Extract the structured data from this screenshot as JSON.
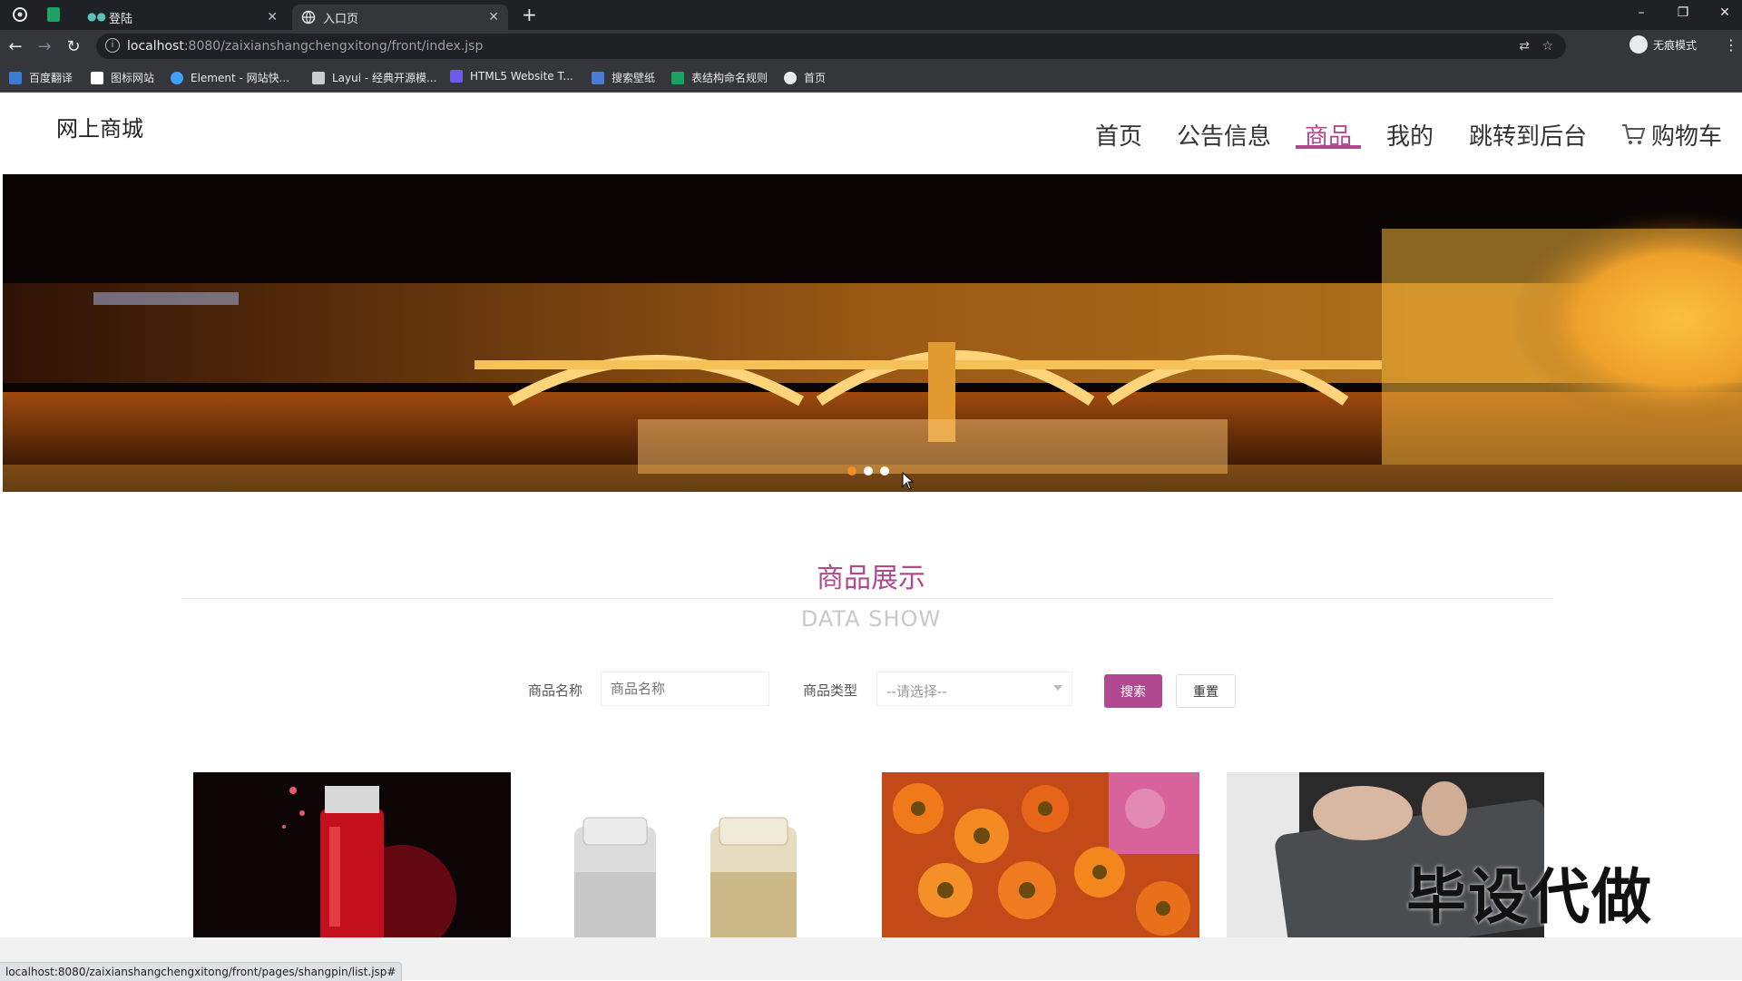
{
  "browser": {
    "tabs": [
      {
        "title": "登陆",
        "active": false
      },
      {
        "title": "入口页",
        "active": true
      }
    ],
    "new_tab": "+",
    "window_controls": {
      "minimize": "–",
      "maximize": "❐",
      "close": "✕"
    },
    "url_host": "localhost",
    "url_rest": ":8080/zaixianshangchengxitong/front/index.jsp",
    "profile_label": "无痕模式",
    "bookmarks": [
      {
        "label": "百度翻译",
        "color": "#3a7bd5"
      },
      {
        "label": "图标网站",
        "color": "#ffffff"
      },
      {
        "label": "Element - 网站快...",
        "color": "#409eff"
      },
      {
        "label": "Layui - 经典开源模...",
        "color": "#cccccc"
      },
      {
        "label": "HTML5 Website T...",
        "color": "#6c5ce7"
      },
      {
        "label": "搜索壁纸",
        "color": "#4a7bd5"
      },
      {
        "label": "表结构命名规则",
        "color": "#1aa260"
      },
      {
        "label": "首页",
        "color": "#e8eaed"
      }
    ],
    "status_url": "localhost:8080/zaixianshangchengxitong/front/pages/shangpin/list.jsp#"
  },
  "site": {
    "logo": "网上商城",
    "nav": [
      {
        "label": "首页",
        "active": false
      },
      {
        "label": "公告信息",
        "active": false
      },
      {
        "label": "商品",
        "active": true
      },
      {
        "label": "我的",
        "active": false
      },
      {
        "label": "跳转到后台",
        "active": false
      },
      {
        "label": "购物车",
        "active": false
      }
    ],
    "accent_color": "#b2488f"
  },
  "banner": {
    "slides": 3,
    "active_slide": 1
  },
  "section": {
    "title_cn": "商品展示",
    "title_en": "DATA SHOW"
  },
  "search": {
    "name_label": "商品名称",
    "name_placeholder": "商品名称",
    "type_label": "商品类型",
    "type_selected": "--请选择--",
    "search_button": "搜索",
    "reset_button": "重置"
  },
  "products": [
    {
      "image": "red-cosmetic-bottle"
    },
    {
      "image": "perfume-bottles"
    },
    {
      "image": "orange-flowers"
    },
    {
      "image": "tablet-in-hand"
    }
  ],
  "watermark": "毕设代做"
}
